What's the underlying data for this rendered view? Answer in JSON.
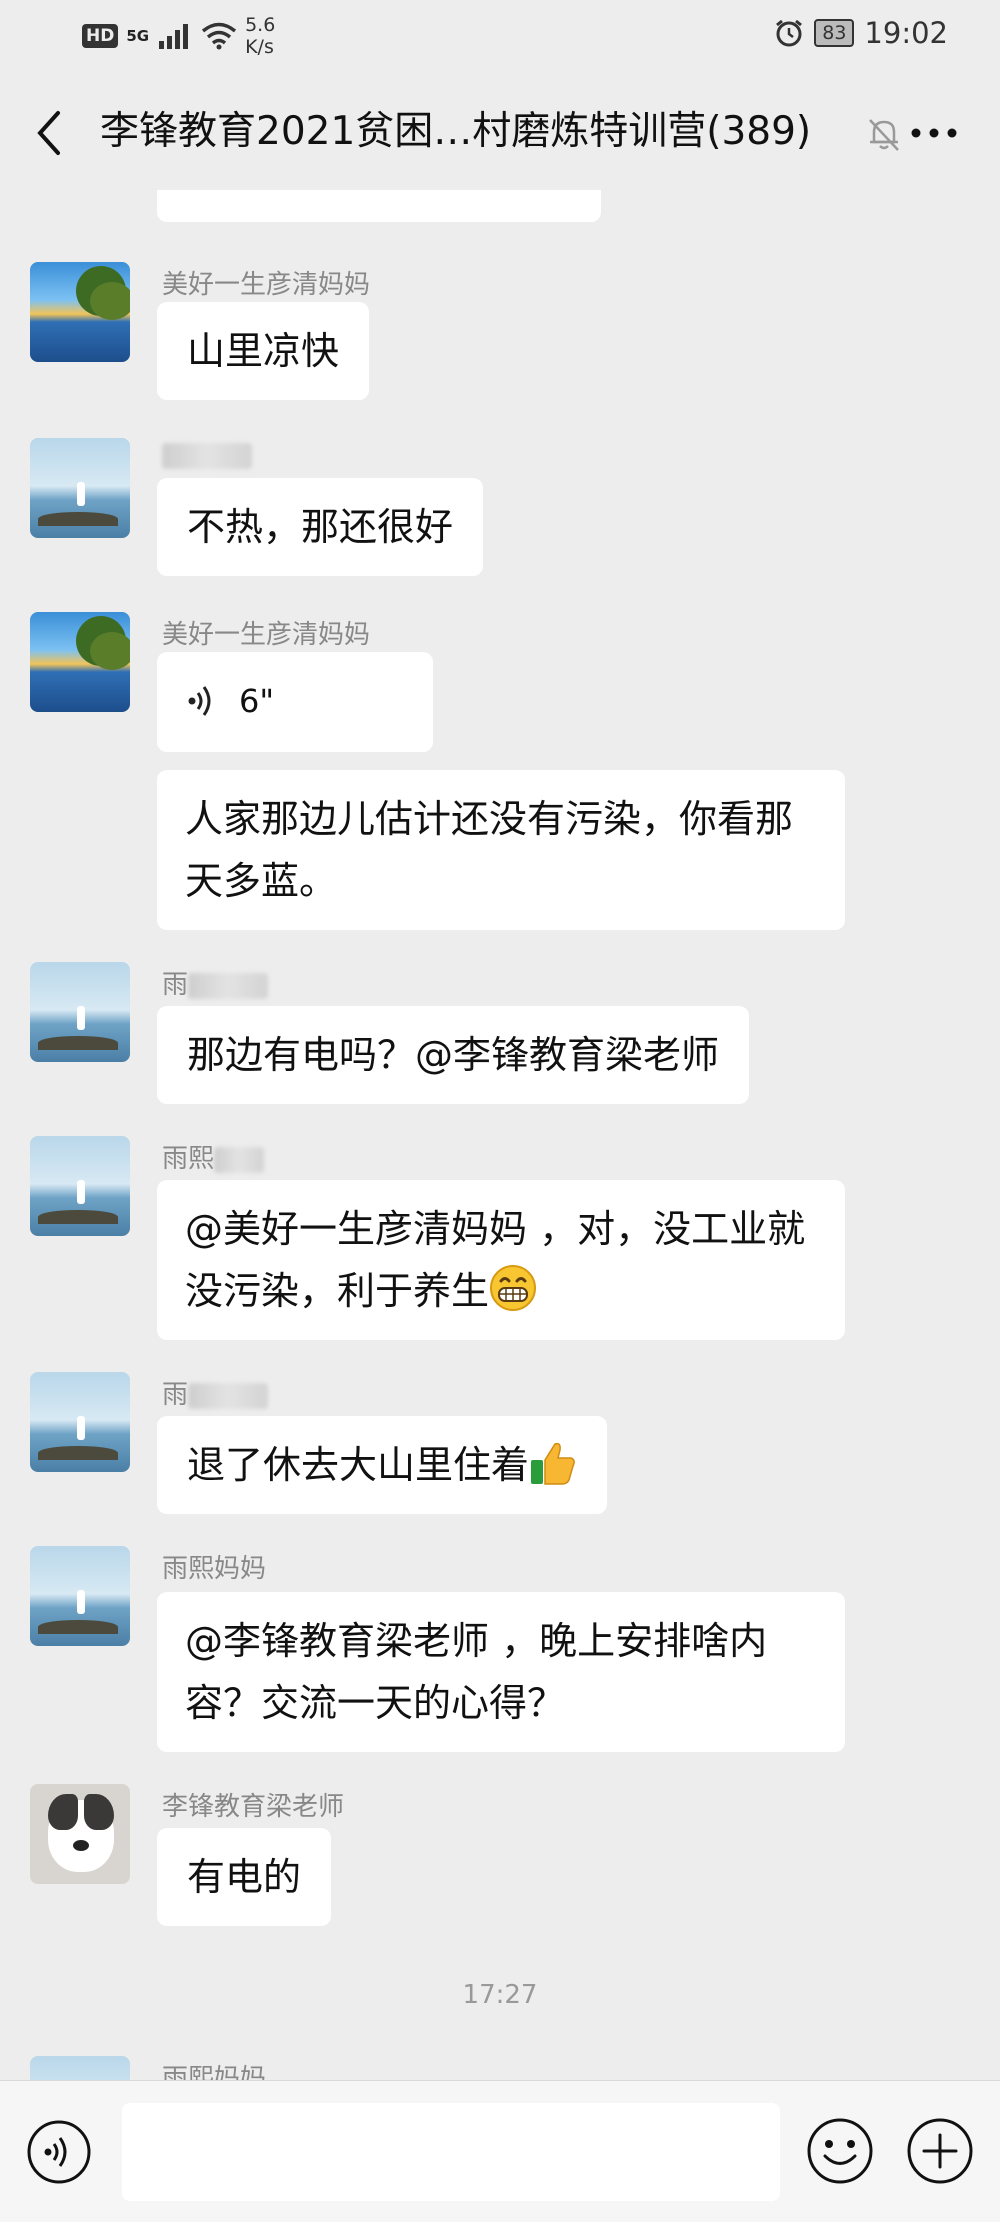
{
  "status_bar": {
    "hd": "HD",
    "network": "5G",
    "speed_value": "5.6",
    "speed_unit": "K/s",
    "battery": "83",
    "time": "19:02"
  },
  "header": {
    "title": "李锋教育2021贫困…村磨炼特训营(389)",
    "back_icon": "chevron-left-icon",
    "mute_icon": "bell-muted-icon",
    "more_icon": "more-dots-icon"
  },
  "messages": [
    {
      "sender": "美好一生彦清妈妈",
      "text": "山里凉快"
    },
    {
      "sender": "",
      "text": "不热，那还很好"
    },
    {
      "sender": "美好一生彦清妈妈",
      "voice_duration": "6\""
    },
    {
      "text": "人家那边儿估计还没有污染，你看那天多蓝。"
    },
    {
      "sender": "雨",
      "text": "那边有电吗？@李锋教育梁老师"
    },
    {
      "sender": "雨熙",
      "text": "@美好一生彦清妈妈 ，对，没工业就没污染，利于养生"
    },
    {
      "sender": "雨",
      "text": "退了休去大山里住着"
    },
    {
      "sender": "雨熙妈妈",
      "text": "@李锋教育梁老师 ，晚上安排啥内容？交流一天的心得？"
    },
    {
      "sender": "李锋教育梁老师",
      "text": "有电的"
    },
    {
      "sender": "雨熙妈妈"
    }
  ],
  "timestamp": "17:27",
  "input_bar": {
    "voice_icon": "voice-input-icon",
    "emoji_icon": "emoji-icon",
    "plus_icon": "plus-icon",
    "input_value": ""
  }
}
